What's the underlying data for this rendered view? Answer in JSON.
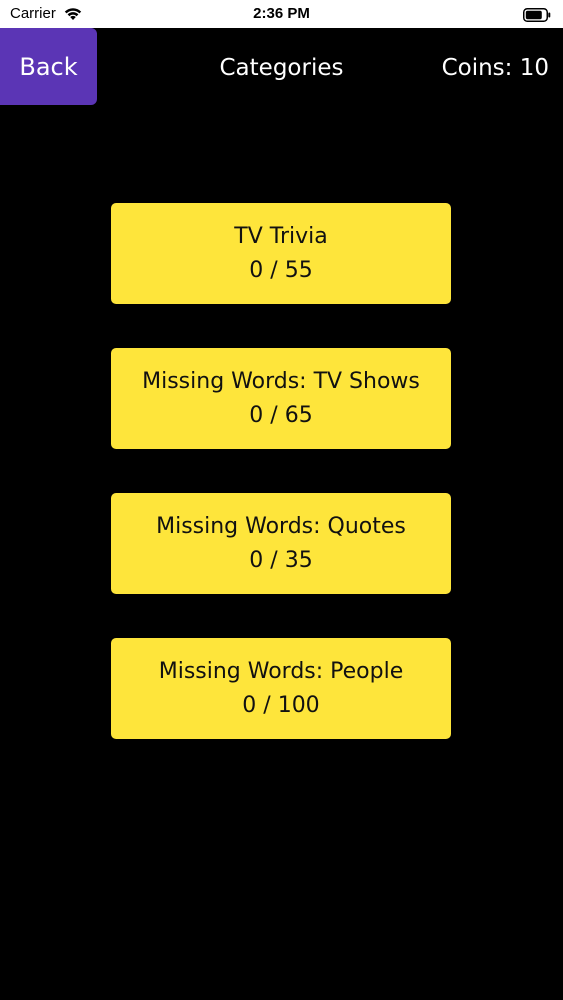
{
  "status_bar": {
    "carrier": "Carrier",
    "time": "2:36 PM",
    "wifi_icon": "wifi-icon",
    "battery_icon": "battery-icon"
  },
  "nav": {
    "back_label": "Back",
    "title": "Categories",
    "coins": "Coins: 10"
  },
  "colors": {
    "background": "#000000",
    "back_button": "#5b35b5",
    "card": "#fee53b",
    "card_text": "#111111",
    "nav_text": "#ffffff"
  },
  "categories": [
    {
      "name": "TV Trivia",
      "progress": "0 / 55"
    },
    {
      "name": "Missing Words: TV Shows",
      "progress": "0 / 65"
    },
    {
      "name": "Missing Words: Quotes",
      "progress": "0 / 35"
    },
    {
      "name": "Missing Words: People",
      "progress": "0 / 100"
    }
  ]
}
